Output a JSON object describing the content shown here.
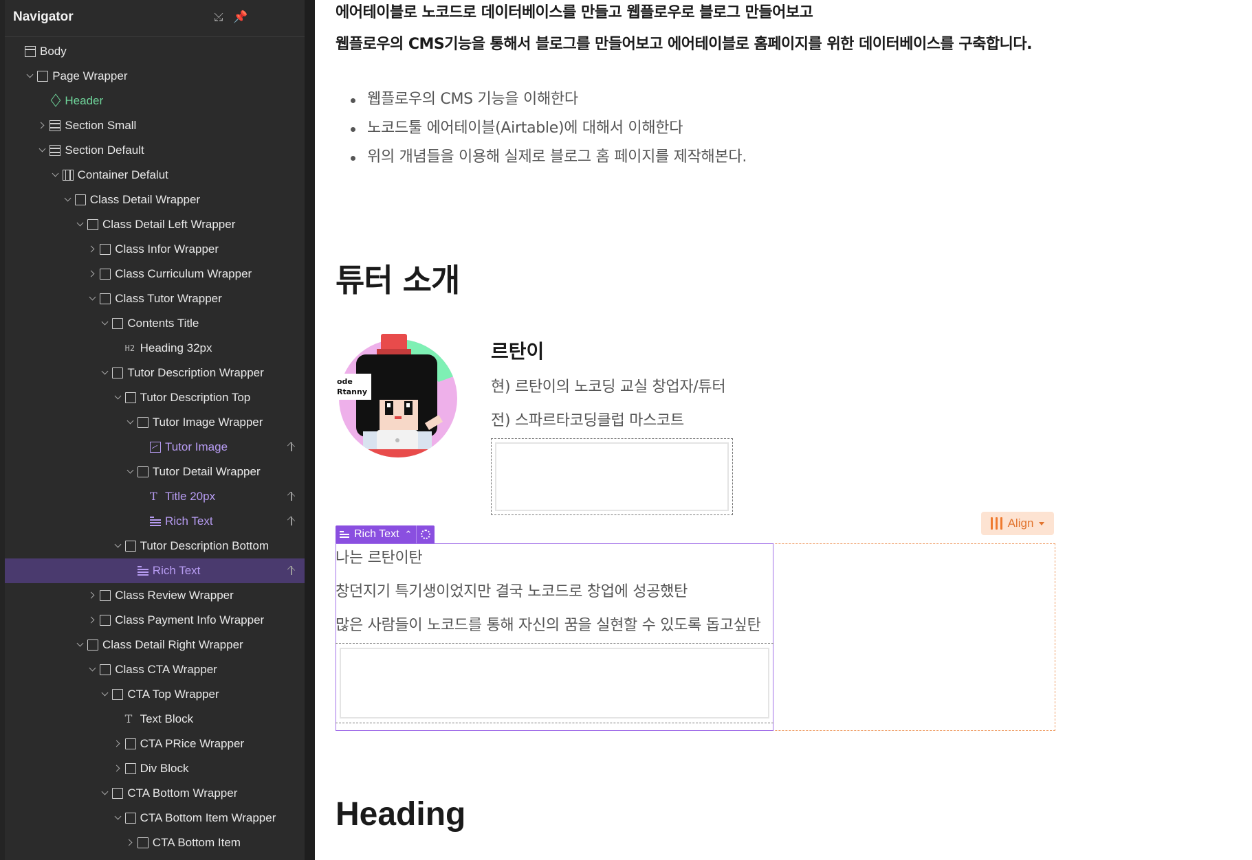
{
  "navigator": {
    "title": "Navigator",
    "close_icon": "collapse-icon",
    "pin_icon": "pin-icon",
    "items": [
      {
        "label": "Body",
        "icon": "body-icon",
        "indent": 0,
        "chevron": "none"
      },
      {
        "label": "Page Wrapper",
        "icon": "box-icon",
        "indent": 1,
        "chevron": "down"
      },
      {
        "label": "Header",
        "icon": "component-icon",
        "indent": 2,
        "chevron": "none",
        "color": "green"
      },
      {
        "label": "Section Small",
        "icon": "section-icon",
        "indent": 2,
        "chevron": "right"
      },
      {
        "label": "Section Default",
        "icon": "section-icon",
        "indent": 2,
        "chevron": "down"
      },
      {
        "label": "Container Defalut",
        "icon": "container-icon",
        "indent": 3,
        "chevron": "down"
      },
      {
        "label": "Class Detail Wrapper",
        "icon": "box-icon",
        "indent": 4,
        "chevron": "down"
      },
      {
        "label": "Class Detail Left Wrapper",
        "icon": "box-icon",
        "indent": 5,
        "chevron": "down"
      },
      {
        "label": "Class Infor Wrapper",
        "icon": "box-icon",
        "indent": 6,
        "chevron": "right"
      },
      {
        "label": "Class Curriculum Wrapper",
        "icon": "box-icon",
        "indent": 6,
        "chevron": "right"
      },
      {
        "label": "Class Tutor Wrapper",
        "icon": "box-icon",
        "indent": 6,
        "chevron": "down"
      },
      {
        "label": "Contents Title",
        "icon": "box-icon",
        "indent": 7,
        "chevron": "down"
      },
      {
        "label": "Heading 32px",
        "icon": "h2-icon",
        "icon_text": "H2",
        "indent": 8,
        "chevron": "none"
      },
      {
        "label": "Tutor Description Wrapper",
        "icon": "box-icon",
        "indent": 7,
        "chevron": "down"
      },
      {
        "label": "Tutor Description Top",
        "icon": "box-icon",
        "indent": 8,
        "chevron": "down"
      },
      {
        "label": "Tutor Image Wrapper",
        "icon": "box-icon",
        "indent": 9,
        "chevron": "down"
      },
      {
        "label": "Tutor Image",
        "icon": "image-icon",
        "indent": 10,
        "chevron": "none",
        "color": "purple",
        "pin": true
      },
      {
        "label": "Tutor Detail Wrapper",
        "icon": "box-icon",
        "indent": 9,
        "chevron": "down"
      },
      {
        "label": "Title 20px",
        "icon": "text-icon",
        "icon_text": "T",
        "indent": 10,
        "chevron": "none",
        "color": "purple",
        "pin": true
      },
      {
        "label": "Rich Text",
        "icon": "rich-text-icon",
        "indent": 10,
        "chevron": "none",
        "color": "purple",
        "pin": true
      },
      {
        "label": "Tutor Description Bottom",
        "icon": "box-icon",
        "indent": 8,
        "chevron": "down"
      },
      {
        "label": "Rich Text",
        "icon": "rich-text-icon",
        "indent": 9,
        "chevron": "none",
        "color": "purple",
        "pin": true,
        "selected": true
      },
      {
        "label": "Class Review Wrapper",
        "icon": "box-icon",
        "indent": 6,
        "chevron": "right"
      },
      {
        "label": "Class Payment Info Wrapper",
        "icon": "box-icon",
        "indent": 6,
        "chevron": "right"
      },
      {
        "label": "Class Detail Right Wrapper",
        "icon": "box-icon",
        "indent": 5,
        "chevron": "down"
      },
      {
        "label": "Class CTA Wrapper",
        "icon": "box-icon",
        "indent": 6,
        "chevron": "down"
      },
      {
        "label": "CTA Top Wrapper",
        "icon": "box-icon",
        "indent": 7,
        "chevron": "down"
      },
      {
        "label": "Text Block",
        "icon": "text-icon",
        "icon_text": "T",
        "indent": 8,
        "chevron": "none"
      },
      {
        "label": "CTA PRice Wrapper",
        "icon": "box-icon",
        "indent": 8,
        "chevron": "right"
      },
      {
        "label": "Div Block",
        "icon": "box-icon",
        "indent": 8,
        "chevron": "right"
      },
      {
        "label": "CTA Bottom Wrapper",
        "icon": "box-icon",
        "indent": 7,
        "chevron": "down"
      },
      {
        "label": "CTA Bottom Item Wrapper",
        "icon": "box-icon",
        "indent": 8,
        "chevron": "down"
      },
      {
        "label": "CTA Bottom Item",
        "icon": "box-icon",
        "indent": 9,
        "chevron": "right"
      }
    ]
  },
  "canvas": {
    "intro_title": "에어테이블로 노코드로 데이터베이스를 만들고 웹플로우로 블로그 만들어보고",
    "intro_desc": "웹플로우의 CMS기능을 통해서 블로그를 만들어보고 에어테이블로 홈페이지를 위한 데이터베이스를 구축합니다.",
    "bullets": [
      "웹플로우의 CMS 기능을 이해한다",
      "노코드툴 에어테이블(Airtable)에 대해서 이해한다",
      "위의 개념들을 이용해 실제로 블로그 홈 페이지를 제작해본다."
    ],
    "tutor_heading": "튜터 소개",
    "avatar_sign": [
      "ode",
      "Rtanny"
    ],
    "tutor_name": "르탄이",
    "tutor_lines": [
      "현) 르탄이의 노코딩 교실 창업자/튜터",
      "전) 스파르타코딩클럽 마스코트"
    ],
    "rich_text_badge": "Rich Text",
    "align_button": "Align",
    "rich_text_lines": [
      "나는 르탄이탄",
      "창던지기 특기생이었지만 결국 노코드로 창업에 성공했탄",
      "많은 사람들이 노코드를 통해 자신의 꿈을 실현할 수 있도록 돕고싶탄"
    ],
    "heading": "Heading"
  },
  "colors": {
    "nav_bg": "#2b2b2b",
    "selected_row": "#4a3a6e",
    "purple_accent": "#b79cf2",
    "green_component": "#6fd49a",
    "selection_border": "#a06ee8",
    "align_orange": "#ef7a2e"
  }
}
